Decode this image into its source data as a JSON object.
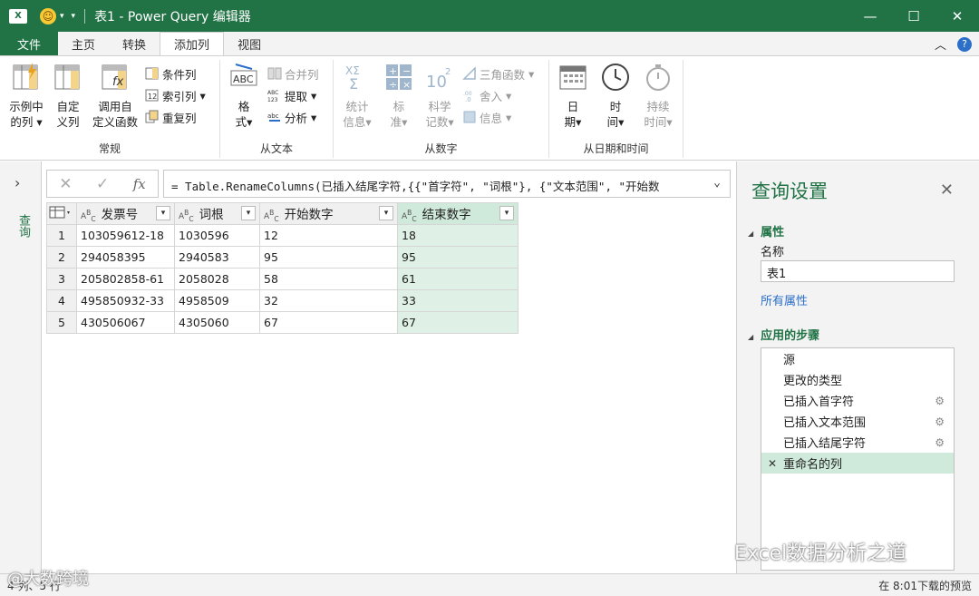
{
  "titlebar": {
    "app_badge": "X",
    "title": "表1 - Power Query 编辑器",
    "minimize": "—",
    "maximize": "☐",
    "close": "✕"
  },
  "ribbon_tabs": [
    "文件",
    "主页",
    "转换",
    "添加列",
    "视图"
  ],
  "ribbon": {
    "group_general": {
      "label": "常规",
      "example_col": [
        "示例中",
        "的列"
      ],
      "custom_col": [
        "自定",
        "义列"
      ],
      "invoke_fn": [
        "调用自",
        "定义函数"
      ],
      "conditional_col": "条件列",
      "index_col": "索引列",
      "duplicate_col": "重复列"
    },
    "group_text": {
      "label": "从文本",
      "format": [
        "格",
        "式"
      ],
      "merge_col": "合并列",
      "extract": "提取",
      "parse": "分析"
    },
    "group_number": {
      "label": "从数字",
      "statistics": [
        "统计",
        "信息"
      ],
      "standard": [
        "标",
        "准"
      ],
      "scientific": [
        "科学",
        "记数"
      ],
      "trig": "三角函数",
      "rounding": "舍入",
      "info": "信息"
    },
    "group_datetime": {
      "label": "从日期和时间",
      "date": [
        "日",
        "期"
      ],
      "time": [
        "时",
        "间"
      ],
      "duration": [
        "持续",
        "时间"
      ]
    }
  },
  "leftnav": {
    "label": "查询"
  },
  "formula": {
    "text": "= Table.RenameColumns(已插入结尾字符,{{\"首字符\", \"词根\"}, {\"文本范围\", \"开始数"
  },
  "table": {
    "columns": [
      "发票号",
      "词根",
      "开始数字",
      "结束数字"
    ],
    "rows": [
      {
        "n": "1",
        "cells": [
          "103059612-18",
          "1030596",
          "12",
          "18"
        ]
      },
      {
        "n": "2",
        "cells": [
          "294058395",
          "2940583",
          "95",
          "95"
        ]
      },
      {
        "n": "3",
        "cells": [
          "205802858-61",
          "2058028",
          "58",
          "61"
        ]
      },
      {
        "n": "4",
        "cells": [
          "495850932-33",
          "4958509",
          "32",
          "33"
        ]
      },
      {
        "n": "5",
        "cells": [
          "430506067",
          "4305060",
          "67",
          "67"
        ]
      }
    ]
  },
  "query_settings": {
    "title": "查询设置",
    "properties_header": "属性",
    "name_label": "名称",
    "name_value": "表1",
    "all_properties": "所有属性",
    "steps_header": "应用的步骤",
    "steps": [
      "源",
      "更改的类型",
      "已插入首字符",
      "已插入文本范围",
      "已插入结尾字符",
      "重命名的列"
    ]
  },
  "statusbar": {
    "left": "4 列、5 行",
    "right": "在 8:01下载的预览"
  },
  "watermarks": {
    "wechat": "Excel数据分析之道",
    "corner": "@大数跨境"
  },
  "colors": {
    "accent": "#217346",
    "selected": "#cfe9da"
  }
}
